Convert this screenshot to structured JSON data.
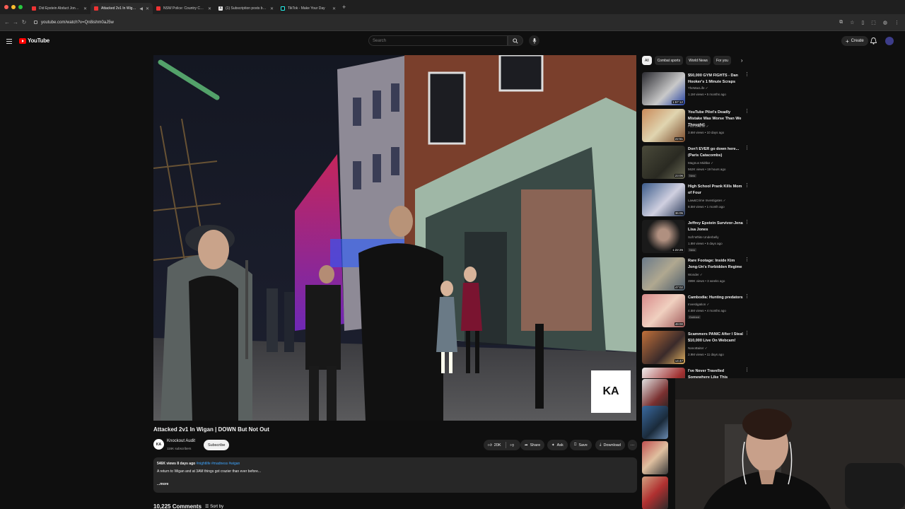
{
  "browser": {
    "tabs": [
      {
        "label": "Did Epstein Abduct JonBenét"
      },
      {
        "label": "Attacked 2v1 In Wigan | D"
      },
      {
        "label": "NSW Police: Country Cop vs"
      },
      {
        "label": "(1) Subscription posts by W"
      },
      {
        "label": "TikTok - Make Your Day"
      }
    ],
    "new_tab": "+",
    "url": "youtube.com/watch?v=Qn8ishm0aJ5w"
  },
  "youtube": {
    "logo_text": "YouTube",
    "search_placeholder": "Search",
    "create_label": "Create"
  },
  "video": {
    "title": "Attacked 2v1 In Wigan | DOWN But Not Out",
    "channel": "Knockout Audit",
    "channel_avatar": "KA",
    "subscribers": "116K subscribers",
    "subscribe_label": "Subscribe",
    "likes": "20K",
    "share_label": "Share",
    "ask_label": "Ask",
    "save_label": "Save",
    "download_label": "Download",
    "watermark": "KA",
    "description": {
      "meta": "546K views  8 days ago",
      "tags": "#nightlife #madness #wigan",
      "text": "A return to Wigan and at 3AM things got crazier than ever before...",
      "more": "...more"
    },
    "comments_count": "10,225 Comments",
    "sort_label": "Sort by"
  },
  "chips": [
    {
      "label": "All",
      "selected": true
    },
    {
      "label": "Combat sports",
      "selected": false
    },
    {
      "label": "World News",
      "selected": false
    },
    {
      "label": "For you",
      "selected": false
    }
  ],
  "recommendations": [
    {
      "title": "$50,000 GYM FIGHTS - Dan Hooker's 1 Minute Scraps",
      "channel": "TheMacLife ✓",
      "meta": "1.1M views • 5 months ago",
      "duration": "1:57:12",
      "badge": ""
    },
    {
      "title": "YouTube Pilot's Deadly Mistake Was Worse Than We Thought!",
      "channel": "Pilot Debrief ✓",
      "meta": "3.6M views • 10 days ago",
      "duration": "22:51",
      "badge": ""
    },
    {
      "title": "Don't EVER go down here... (Paris Catacombs)",
      "channel": "Magnus Midtbø ✓",
      "meta": "562K views • 19 hours ago",
      "duration": "23:06",
      "badge": "New"
    },
    {
      "title": "High School Prank Kills Mom of Four",
      "channel": "Law&Crime Investigates ✓",
      "meta": "8.5M views • 1 month ago",
      "duration": "36:05",
      "badge": ""
    },
    {
      "title": "Jeffrey Epstein Survivor-Jena Lisa Jones",
      "channel": "Soft White Underbelly",
      "meta": "1.8M views • 5 days ago",
      "duration": "1:22:26",
      "badge": "New"
    },
    {
      "title": "Rare Footage: Inside Kim Jong-Un's Forbidden Regime",
      "channel": "Wonder ✓",
      "meta": "399K views • 3 weeks ago",
      "duration": "47:02",
      "badge": ""
    },
    {
      "title": "Cambodia: Hunting predators",
      "channel": "Investigation ✓",
      "meta": "4.5M views • 4 months ago",
      "duration": "49:00",
      "badge": "Dubbed"
    },
    {
      "title": "Scammers PANIC After I Steal $10,000 Live On Webcam!",
      "channel": "NanoBaiter ✓",
      "meta": "2.9M views • 11 days ago",
      "duration": "14:47",
      "badge": ""
    },
    {
      "title": "I've Never Travelled Somewhere Like This (Remote PNG)",
      "channel": "",
      "meta": "",
      "duration": "",
      "badge": ""
    }
  ],
  "colors": {
    "background": "#0f0f0f",
    "brand_red": "#ff0000",
    "link_blue": "#3ea6ff"
  }
}
